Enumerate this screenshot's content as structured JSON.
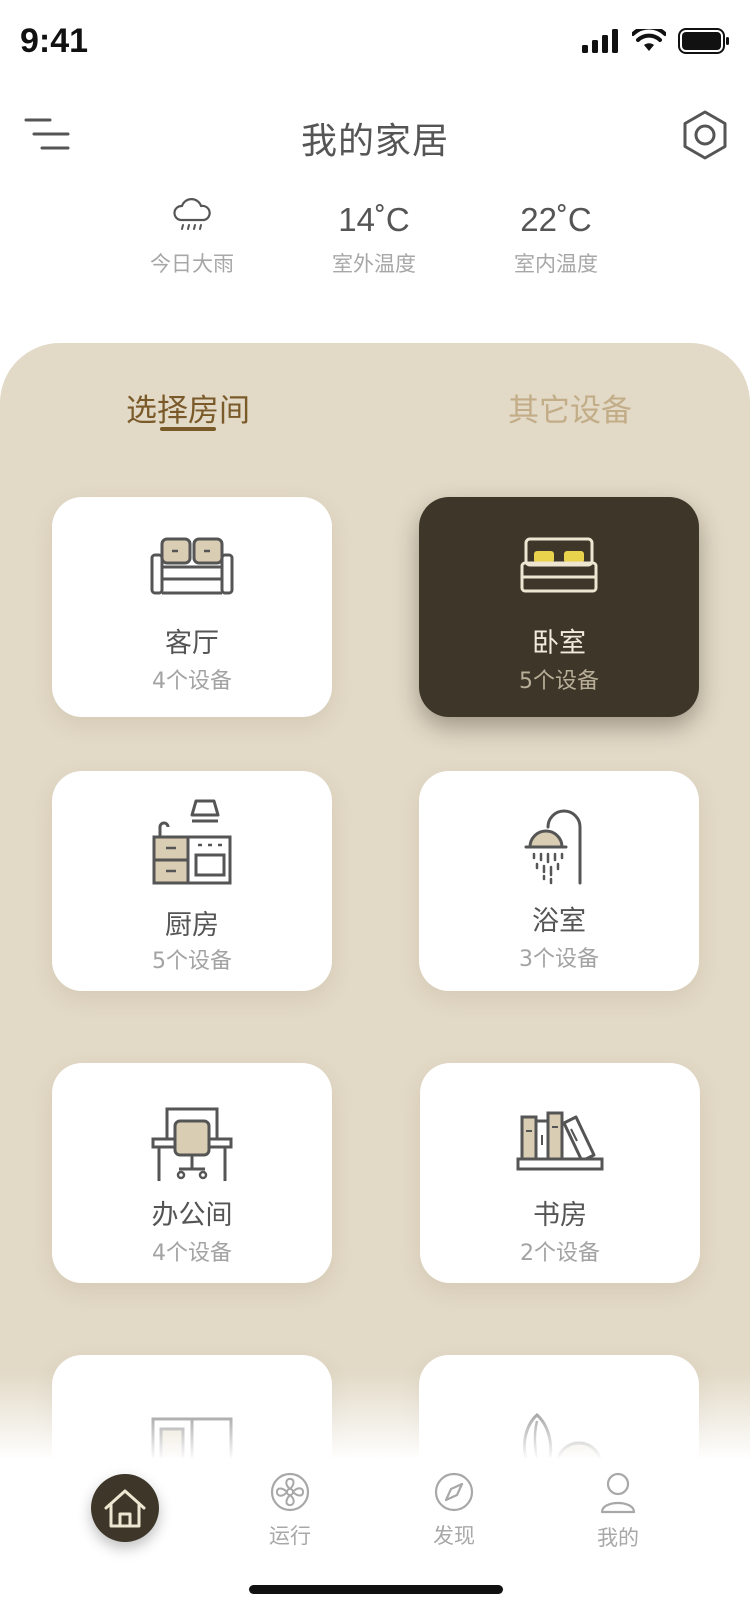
{
  "status_bar": {
    "time": "9:41"
  },
  "header": {
    "title": "我的家居",
    "menu_icon": "menu-icon",
    "settings_icon": "hexagon-settings-icon"
  },
  "weather": [
    {
      "value": "",
      "label": "今日大雨",
      "icon": "rain-cloud-icon"
    },
    {
      "value": "14˚C",
      "label": "室外温度"
    },
    {
      "value": "22˚C",
      "label": "室内温度"
    }
  ],
  "tabs": {
    "active": "选择房间",
    "inactive": "其它设备"
  },
  "rooms": [
    {
      "name": "客厅",
      "count": "4个设备",
      "icon": "sofa-icon",
      "active": false
    },
    {
      "name": "卧室",
      "count": "5个设备",
      "icon": "bed-icon",
      "active": true
    },
    {
      "name": "厨房",
      "count": "5个设备",
      "icon": "kitchen-icon",
      "active": false
    },
    {
      "name": "浴室",
      "count": "3个设备",
      "icon": "shower-icon",
      "active": false
    },
    {
      "name": "办公间",
      "count": "4个设备",
      "icon": "desk-icon",
      "active": false
    },
    {
      "name": "书房",
      "count": "2个设备",
      "icon": "books-icon",
      "active": false
    }
  ],
  "bottom_nav": {
    "home_icon": "home-icon",
    "items": [
      {
        "label": "运行",
        "icon": "fan-icon"
      },
      {
        "label": "发现",
        "icon": "compass-icon"
      },
      {
        "label": "我的",
        "icon": "user-icon"
      }
    ]
  },
  "colors": {
    "accent_dark": "#3e3629",
    "panel_bg": "#e2d9c6",
    "tab_active": "#7b5a2a",
    "tab_inactive": "#c2ad88",
    "pillow_yellow": "#e9d24c"
  }
}
